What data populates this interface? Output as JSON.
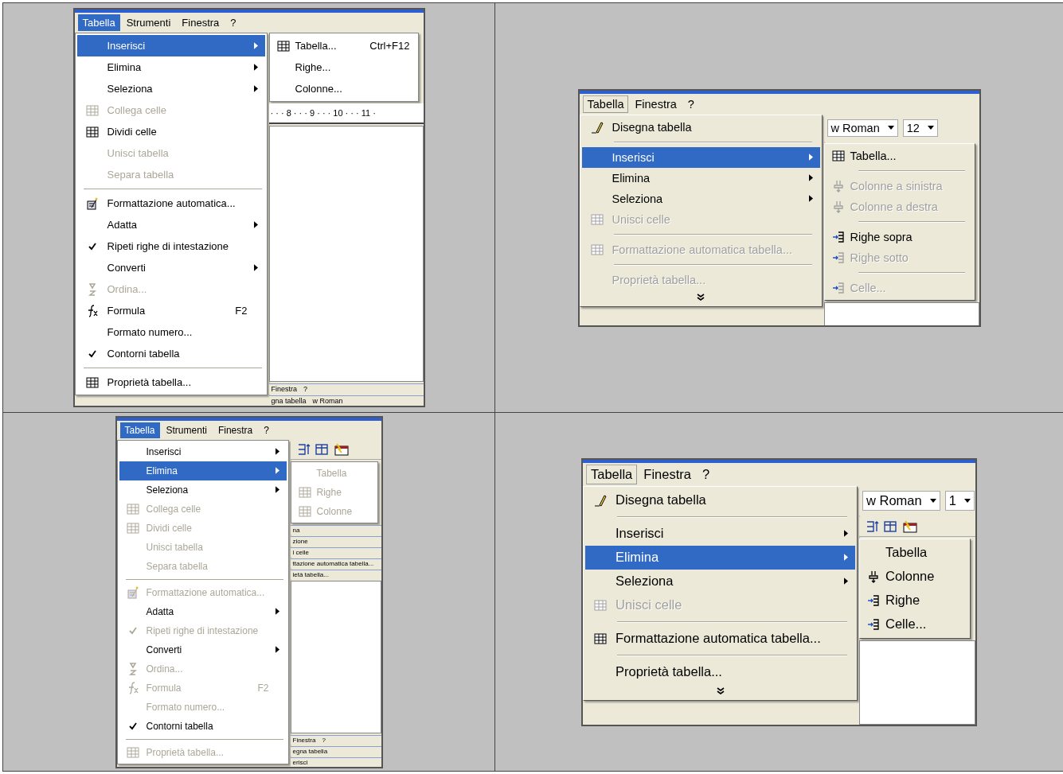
{
  "panels": [
    {
      "kind": "xp",
      "menubar": [
        {
          "label": "Tabella",
          "selected": true
        },
        {
          "label": "Strumenti",
          "selected": false
        },
        {
          "label": "Finestra",
          "selected": false
        },
        {
          "label": "?",
          "selected": false
        }
      ],
      "menu": [
        {
          "kind": "item",
          "label": "Inserisci",
          "submenu": true,
          "selected": true,
          "disabled": false,
          "checked": false
        },
        {
          "kind": "item",
          "label": "Elimina",
          "submenu": true,
          "selected": false,
          "disabled": false,
          "checked": false
        },
        {
          "kind": "item",
          "label": "Seleziona",
          "submenu": true,
          "selected": false,
          "disabled": false,
          "checked": false
        },
        {
          "kind": "item",
          "label": "Collega celle",
          "submenu": false,
          "selected": false,
          "disabled": true,
          "checked": false
        },
        {
          "kind": "item",
          "label": "Dividi celle",
          "submenu": false,
          "selected": false,
          "disabled": false,
          "checked": false
        },
        {
          "kind": "item",
          "label": "Unisci tabella",
          "submenu": false,
          "selected": false,
          "disabled": true,
          "checked": false
        },
        {
          "kind": "item",
          "label": "Separa tabella",
          "submenu": false,
          "selected": false,
          "disabled": true,
          "checked": false
        },
        {
          "kind": "separator"
        },
        {
          "kind": "item",
          "label": "Formattazione automatica...",
          "submenu": false,
          "selected": false,
          "disabled": false,
          "checked": false
        },
        {
          "kind": "item",
          "label": "Adatta",
          "submenu": true,
          "selected": false,
          "disabled": false,
          "checked": false
        },
        {
          "kind": "item",
          "label": "Ripeti righe di intestazione",
          "submenu": false,
          "selected": false,
          "disabled": false,
          "checked": true
        },
        {
          "kind": "item",
          "label": "Converti",
          "submenu": true,
          "selected": false,
          "disabled": false,
          "checked": false
        },
        {
          "kind": "item",
          "label": "Ordina...",
          "submenu": false,
          "selected": false,
          "disabled": true,
          "checked": false
        },
        {
          "kind": "item",
          "label": "Formula",
          "shortcut": "F2",
          "submenu": false,
          "selected": false,
          "disabled": false,
          "checked": false
        },
        {
          "kind": "item",
          "label": "Formato numero...",
          "submenu": false,
          "selected": false,
          "disabled": false,
          "checked": false
        },
        {
          "kind": "item",
          "label": "Contorni tabella",
          "submenu": false,
          "selected": false,
          "disabled": false,
          "checked": true
        },
        {
          "kind": "separator"
        },
        {
          "kind": "item",
          "label": "Proprietà tabella...",
          "submenu": false,
          "selected": false,
          "disabled": false,
          "checked": false
        }
      ],
      "right": [
        {
          "kind": "submenu",
          "items": [
            {
              "kind": "item",
              "label": "Tabella...",
              "shortcut": "Ctrl+F12",
              "selected": false,
              "disabled": false
            },
            {
              "kind": "item",
              "label": "Righe...",
              "selected": false,
              "disabled": false
            },
            {
              "kind": "item",
              "label": "Colonne...",
              "selected": false,
              "disabled": false
            }
          ]
        },
        {
          "kind": "ruler",
          "text": "· · · 8 · · · 9 · · · 10 · · · 11 ·"
        },
        {
          "kind": "page"
        },
        {
          "kind": "strip",
          "texts": [
            "Finestra",
            "?"
          ]
        },
        {
          "kind": "strip",
          "texts": [
            "gna tabella",
            "w Roman"
          ]
        }
      ]
    },
    {
      "kind": "classic",
      "menubar": [
        {
          "label": "Tabella",
          "selected": true
        },
        {
          "label": "Finestra",
          "selected": false
        },
        {
          "label": "?",
          "selected": false
        }
      ],
      "menu": [
        {
          "kind": "item",
          "label": "Disegna tabella",
          "submenu": false,
          "selected": false,
          "disabled": false
        },
        {
          "kind": "separator"
        },
        {
          "kind": "item",
          "label": "Inserisci",
          "submenu": true,
          "selected": true,
          "disabled": false
        },
        {
          "kind": "item",
          "label": "Elimina",
          "submenu": true,
          "selected": false,
          "disabled": false
        },
        {
          "kind": "item",
          "label": "Seleziona",
          "submenu": true,
          "selected": false,
          "disabled": false
        },
        {
          "kind": "item",
          "label": "Unisci celle",
          "submenu": false,
          "selected": false,
          "disabled": true
        },
        {
          "kind": "separator"
        },
        {
          "kind": "item",
          "label": "Formattazione automatica tabella...",
          "submenu": false,
          "selected": false,
          "disabled": true
        },
        {
          "kind": "separator"
        },
        {
          "kind": "item",
          "label": "Proprietà tabella...",
          "submenu": false,
          "selected": false,
          "disabled": true
        },
        {
          "kind": "chevron"
        }
      ],
      "right": [
        {
          "kind": "combos",
          "texts": [
            "w Roman",
            "12"
          ]
        },
        {
          "kind": "submenu",
          "items": [
            {
              "kind": "item",
              "label": "Tabella...",
              "selected": false,
              "disabled": false
            },
            {
              "kind": "separator"
            },
            {
              "kind": "item",
              "label": "Colonne a sinistra",
              "selected": false,
              "disabled": true
            },
            {
              "kind": "item",
              "label": "Colonne a destra",
              "selected": false,
              "disabled": true
            },
            {
              "kind": "separator"
            },
            {
              "kind": "item",
              "label": "Righe sopra",
              "selected": false,
              "disabled": false
            },
            {
              "kind": "item",
              "label": "Righe sotto",
              "selected": false,
              "disabled": true
            },
            {
              "kind": "separator"
            },
            {
              "kind": "item",
              "label": "Celle...",
              "selected": false,
              "disabled": true
            }
          ]
        },
        {
          "kind": "page"
        }
      ]
    },
    {
      "kind": "xp",
      "menubar": [
        {
          "label": "Tabella",
          "selected": true
        },
        {
          "label": "Strumenti",
          "selected": false
        },
        {
          "label": "Finestra",
          "selected": false
        },
        {
          "label": "?",
          "selected": false
        }
      ],
      "menu": [
        {
          "kind": "item",
          "label": "Inserisci",
          "submenu": true,
          "selected": false,
          "disabled": false,
          "checked": false
        },
        {
          "kind": "item",
          "label": "Elimina",
          "submenu": true,
          "selected": true,
          "disabled": false,
          "checked": false
        },
        {
          "kind": "item",
          "label": "Seleziona",
          "submenu": true,
          "selected": false,
          "disabled": false,
          "checked": false
        },
        {
          "kind": "item",
          "label": "Collega celle",
          "submenu": false,
          "selected": false,
          "disabled": true,
          "checked": false
        },
        {
          "kind": "item",
          "label": "Dividi celle",
          "submenu": false,
          "selected": false,
          "disabled": true,
          "checked": false
        },
        {
          "kind": "item",
          "label": "Unisci tabella",
          "submenu": false,
          "selected": false,
          "disabled": true,
          "checked": false
        },
        {
          "kind": "item",
          "label": "Separa tabella",
          "submenu": false,
          "selected": false,
          "disabled": true,
          "checked": false
        },
        {
          "kind": "separator"
        },
        {
          "kind": "item",
          "label": "Formattazione automatica...",
          "submenu": false,
          "selected": false,
          "disabled": true,
          "checked": false
        },
        {
          "kind": "item",
          "label": "Adatta",
          "submenu": true,
          "selected": false,
          "disabled": false,
          "checked": false
        },
        {
          "kind": "item",
          "label": "Ripeti righe di intestazione",
          "submenu": false,
          "selected": false,
          "disabled": true,
          "checked": true
        },
        {
          "kind": "item",
          "label": "Converti",
          "submenu": true,
          "selected": false,
          "disabled": false,
          "checked": false
        },
        {
          "kind": "item",
          "label": "Ordina...",
          "submenu": false,
          "selected": false,
          "disabled": true,
          "checked": false
        },
        {
          "kind": "item",
          "label": "Formula",
          "shortcut": "F2",
          "submenu": false,
          "selected": false,
          "disabled": true,
          "checked": false
        },
        {
          "kind": "item",
          "label": "Formato numero...",
          "submenu": false,
          "selected": false,
          "disabled": true,
          "checked": false
        },
        {
          "kind": "item",
          "label": "Contorni tabella",
          "submenu": false,
          "selected": false,
          "disabled": false,
          "checked": true
        },
        {
          "kind": "separator"
        },
        {
          "kind": "item",
          "label": "Proprietà tabella...",
          "submenu": false,
          "selected": false,
          "disabled": true,
          "checked": false
        }
      ],
      "right": [
        {
          "kind": "toolbar"
        },
        {
          "kind": "submenu",
          "items": [
            {
              "kind": "item",
              "label": "Tabella",
              "selected": false,
              "disabled": true
            },
            {
              "kind": "item",
              "label": "Righe",
              "selected": false,
              "disabled": true
            },
            {
              "kind": "item",
              "label": "Colonne",
              "selected": false,
              "disabled": true
            }
          ]
        },
        {
          "kind": "strip",
          "texts": [
            "na"
          ]
        },
        {
          "kind": "strip",
          "texts": [
            "zione"
          ]
        },
        {
          "kind": "strip",
          "texts": [
            "i celle"
          ]
        },
        {
          "kind": "strip",
          "texts": [
            "ttazione automatica tabella..."
          ]
        },
        {
          "kind": "strip",
          "texts": [
            "ietà tabella..."
          ]
        },
        {
          "kind": "page"
        },
        {
          "kind": "strip",
          "texts": [
            "Finestra",
            "?"
          ]
        },
        {
          "kind": "strip",
          "texts": [
            "egna tabella"
          ]
        },
        {
          "kind": "strip",
          "texts": [
            "erisci"
          ]
        }
      ]
    },
    {
      "kind": "classic",
      "menubar": [
        {
          "label": "Tabella",
          "selected": true
        },
        {
          "label": "Finestra",
          "selected": false
        },
        {
          "label": "?",
          "selected": false
        }
      ],
      "menu": [
        {
          "kind": "item",
          "label": "Disegna tabella",
          "submenu": false,
          "selected": false,
          "disabled": false
        },
        {
          "kind": "separator"
        },
        {
          "kind": "item",
          "label": "Inserisci",
          "submenu": true,
          "selected": false,
          "disabled": false
        },
        {
          "kind": "item",
          "label": "Elimina",
          "submenu": true,
          "selected": true,
          "disabled": false
        },
        {
          "kind": "item",
          "label": "Seleziona",
          "submenu": true,
          "selected": false,
          "disabled": false
        },
        {
          "kind": "item",
          "label": "Unisci celle",
          "submenu": false,
          "selected": false,
          "disabled": true
        },
        {
          "kind": "separator"
        },
        {
          "kind": "item",
          "label": "Formattazione automatica tabella...",
          "submenu": false,
          "selected": false,
          "disabled": false
        },
        {
          "kind": "separator"
        },
        {
          "kind": "item",
          "label": "Proprietà tabella...",
          "submenu": false,
          "selected": false,
          "disabled": false
        },
        {
          "kind": "chevron"
        }
      ],
      "right": [
        {
          "kind": "combos",
          "texts": [
            "w Roman",
            "1"
          ]
        },
        {
          "kind": "toolbar"
        },
        {
          "kind": "submenu",
          "items": [
            {
              "kind": "item",
              "label": "Tabella",
              "selected": false,
              "disabled": false
            },
            {
              "kind": "item",
              "label": "Colonne",
              "selected": false,
              "disabled": false
            },
            {
              "kind": "item",
              "label": "Righe",
              "selected": false,
              "disabled": false
            },
            {
              "kind": "item",
              "label": "Celle...",
              "selected": false,
              "disabled": false
            }
          ]
        },
        {
          "kind": "page"
        }
      ]
    }
  ]
}
